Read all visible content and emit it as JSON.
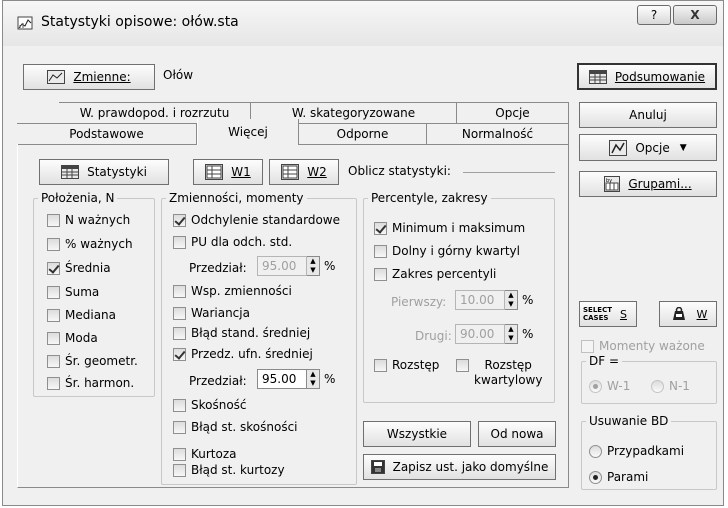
{
  "window": {
    "title": "Statystyki opisowe: ołów.sta",
    "help_label": "?",
    "close_label": "X"
  },
  "top": {
    "zmienne_label": "Zmienne:",
    "variable_value": "Ołów"
  },
  "tabs": {
    "row1": [
      "W. prawdopod. i rozrzutu",
      "W. skategoryzowane",
      "Opcje"
    ],
    "row2": [
      "Podstawowe",
      "Więcej",
      "Odporne",
      "Normalność"
    ]
  },
  "panel": {
    "statystyki_label": "Statystyki",
    "w1_label": "W1",
    "w2_label": "W2",
    "oblicz_label": "Oblicz statystyki:"
  },
  "polozenia": {
    "legend": "Położenia, N",
    "items": [
      {
        "label": "N ważnych",
        "checked": false
      },
      {
        "label": "% ważnych",
        "checked": false
      },
      {
        "label": "Średnia",
        "checked": true
      },
      {
        "label": "Suma",
        "checked": false
      },
      {
        "label": "Mediana",
        "checked": false
      },
      {
        "label": "Moda",
        "checked": false
      },
      {
        "label": "Śr. geometr.",
        "checked": false
      },
      {
        "label": "Śr. harmon.",
        "checked": false
      }
    ]
  },
  "zmiennosci": {
    "legend": "Zmienności, momenty",
    "odchylenie": "Odchylenie standardowe",
    "pu": "PU dla odch. std.",
    "przedzial1_label": "Przedział:",
    "przedzial1_value": "95.00",
    "przedzial1_unit": "%",
    "wsp": "Wsp. zmienności",
    "wariancja": "Wariancja",
    "blad_sred": "Błąd stand. średniej",
    "przedz_ufn": "Przedz. ufn. średniej",
    "przedzial2_label": "Przedział:",
    "przedzial2_value": "95.00",
    "przedzial2_unit": "%",
    "skosnosc": "Skośność",
    "blad_skos": "Błąd st. skośności",
    "kurtoza": "Kurtoza",
    "blad_kurt": "Błąd st. kurtozy"
  },
  "percentyle": {
    "legend": "Percentyle, zakresy",
    "minmax": "Minimum i maksimum",
    "kwartyl": "Dolny i górny kwartyl",
    "zakres": "Zakres percentyli",
    "pierwszy_label": "Pierwszy:",
    "pierwszy_value": "10.00",
    "pierwszy_unit": "%",
    "drugi_label": "Drugi:",
    "drugi_value": "90.00",
    "drugi_unit": "%",
    "rozstep": "Rozstęp",
    "rozstep_kw_1": "Rozstęp",
    "rozstep_kw_2": "kwartylowy"
  },
  "bottom_buttons": {
    "wszystkie": "Wszystkie",
    "od_nowa": "Od nowa",
    "zapisz": "Zapisz ust. jako domyślne"
  },
  "right": {
    "podsumowanie": "Podsumowanie",
    "anuluj": "Anuluj",
    "opcje": "Opcje",
    "grupami": "Grupami...",
    "select_cases_1": "SELECT",
    "select_cases_2": "CASES",
    "s_label": "S",
    "w_label": "W",
    "momenty": "Momenty ważone",
    "df_legend": "DF =",
    "df_w1": "W-1",
    "df_n1": "N-1",
    "usuwanie_legend": "Usuwanie BD",
    "przypadkami": "Przypadkami",
    "parami": "Parami"
  }
}
